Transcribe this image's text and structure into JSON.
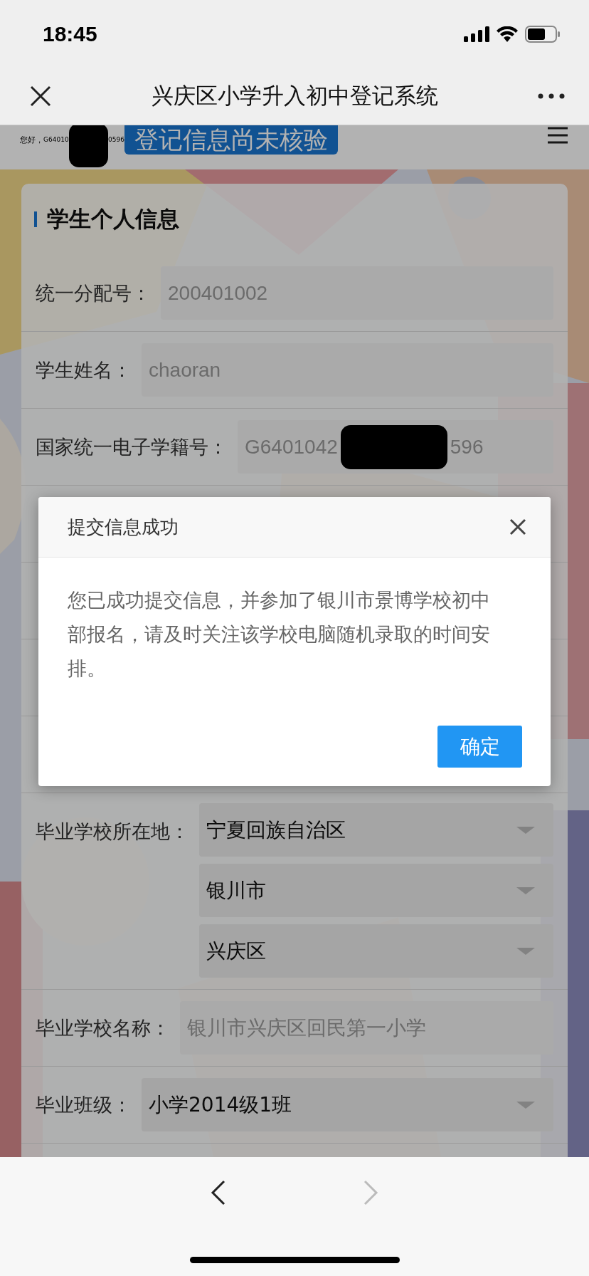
{
  "status_bar": {
    "time": "18:45"
  },
  "nav": {
    "title": "兴庆区小学升入初中登记系统"
  },
  "header": {
    "greeting": "您好，",
    "user_id_fragments": [
      "G64010",
      "0596"
    ],
    "status_badge": "登记信息尚未核验"
  },
  "card": {
    "title": "学生个人信息",
    "rows": [
      {
        "kind": "input",
        "label": "统一分配号：",
        "value": "200401002"
      },
      {
        "kind": "input",
        "label": "学生姓名：",
        "value": "chaoran"
      },
      {
        "kind": "redacted_input",
        "label": "国家统一电子学籍号：",
        "value_fragments": [
          "G6401042",
          "596"
        ]
      },
      {
        "kind": "covered"
      },
      {
        "kind": "covered"
      },
      {
        "kind": "covered"
      },
      {
        "kind": "covered"
      },
      {
        "kind": "selects",
        "label": "毕业学校所在地：",
        "options": [
          "宁夏回族自治区",
          "银川市",
          "兴庆区"
        ]
      },
      {
        "kind": "input",
        "label": "毕业学校名称：",
        "value": "银川市兴庆区回民第一小学"
      },
      {
        "kind": "select",
        "label": "毕业班级：",
        "value": "小学2014级1班"
      }
    ]
  },
  "dialog": {
    "title": "提交信息成功",
    "message": "您已成功提交信息，并参加了银川市景博学校初中部报名，请及时关注该学校电脑随机录取的时间安排。",
    "confirm": "确定"
  },
  "toolbar": {
    "back_disabled": false,
    "forward_disabled": true
  }
}
